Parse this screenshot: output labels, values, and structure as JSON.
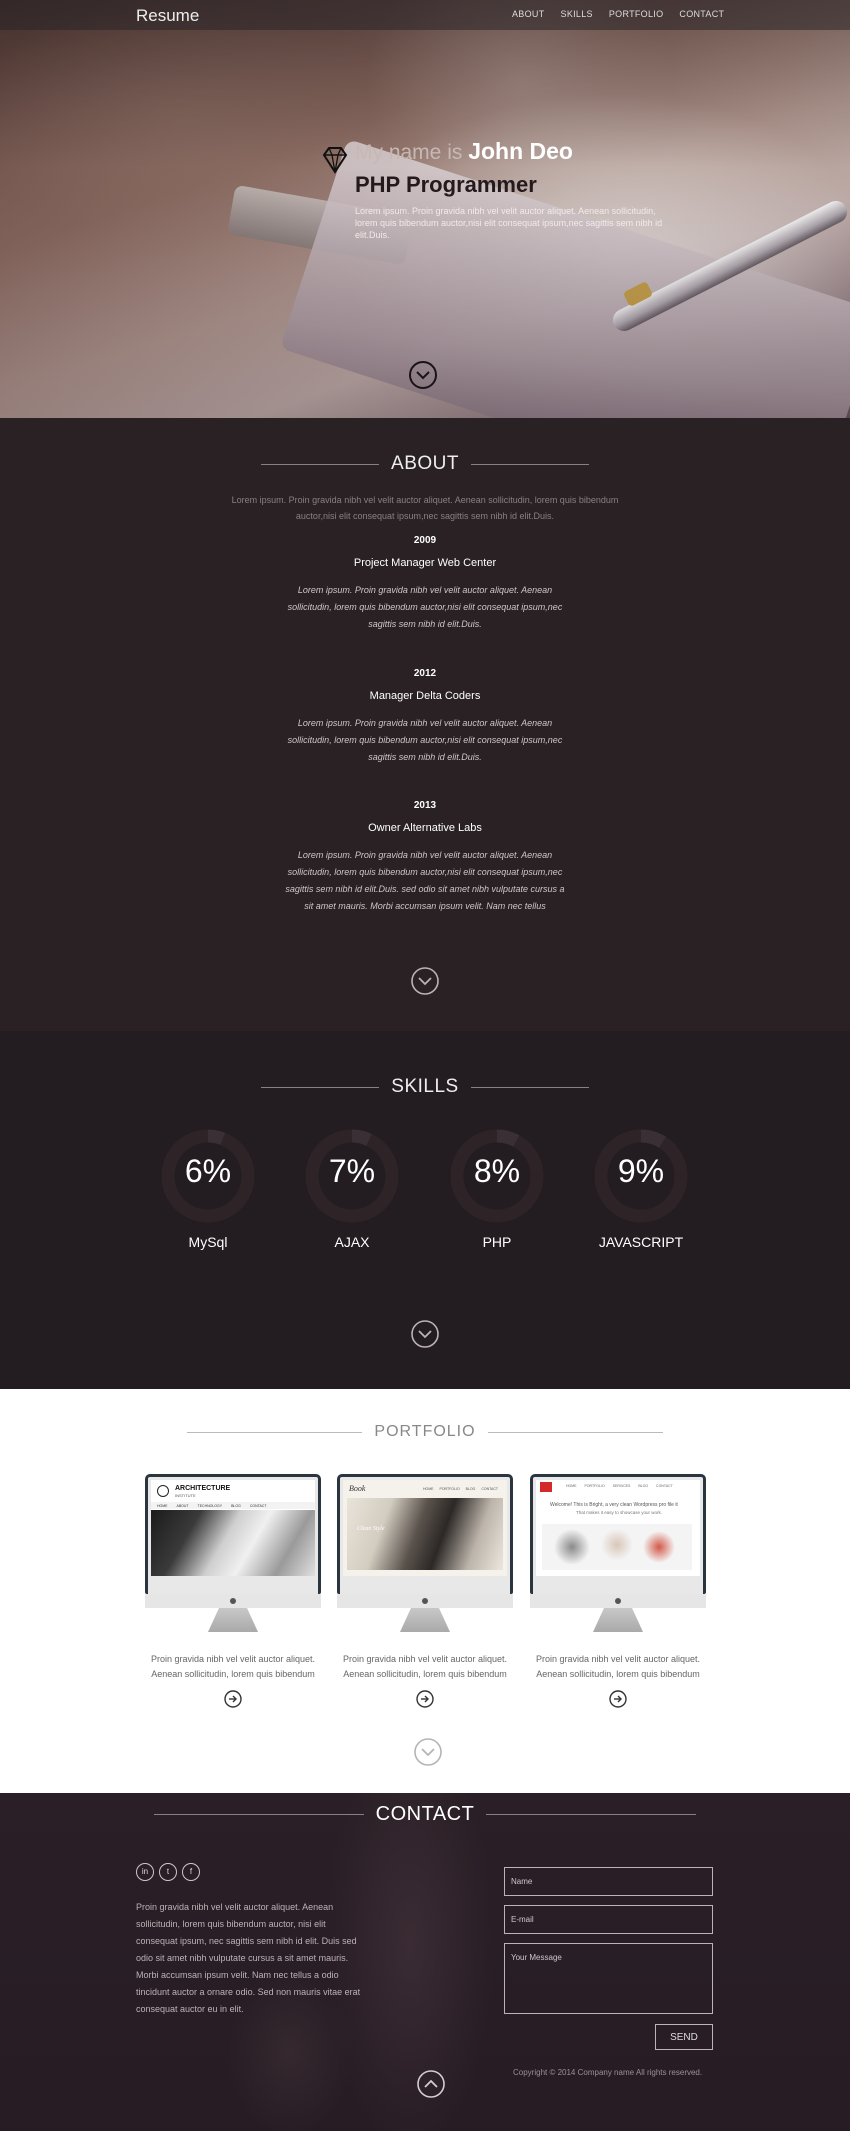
{
  "nav": {
    "brand": "Resume",
    "items": [
      "ABOUT",
      "SKILLS",
      "PORTFOLIO",
      "CONTACT"
    ]
  },
  "hero": {
    "greeting": "My name is ",
    "name": "John Deo",
    "role": "PHP Programmer",
    "desc": "Lorem ipsum. Proin gravida nibh vel velit auctor aliquet. Aenean sollicitudin, lorem quis bibendum auctor,nisi elit consequat ipsum,nec sagittis sem nibh id elit.Duis."
  },
  "about": {
    "title": "ABOUT",
    "intro": "Lorem ipsum. Proin gravida nibh vel velit auctor aliquet. Aenean sollicitudin, lorem quis bibendum auctor,nisi elit consequat ipsum,nec sagittis sem nibh id elit.Duis.",
    "jobs": [
      {
        "year": "2009",
        "title": "Project Manager Web Center",
        "desc": "Lorem ipsum. Proin gravida nibh vel velit auctor aliquet. Aenean sollicitudin, lorem quis bibendum auctor,nisi elit consequat ipsum,nec sagittis sem nibh id elit.Duis."
      },
      {
        "year": "2012",
        "title": "Manager Delta Coders",
        "desc": "Lorem ipsum. Proin gravida nibh vel velit auctor aliquet. Aenean sollicitudin, lorem quis bibendum auctor,nisi elit consequat ipsum,nec sagittis sem nibh id elit.Duis."
      },
      {
        "year": "2013",
        "title": "Owner Alternative Labs",
        "desc": "Lorem ipsum. Proin gravida nibh vel velit auctor aliquet. Aenean sollicitudin, lorem quis bibendum auctor,nisi elit consequat ipsum,nec sagittis sem nibh id elit.Duis. sed odio sit amet nibh vulputate cursus a sit amet mauris. Morbi accumsan ipsum velit. Nam nec tellus"
      }
    ]
  },
  "skills": {
    "title": "SKILLS",
    "items": [
      {
        "pct": "6%",
        "value": 6,
        "name": "MySql"
      },
      {
        "pct": "7%",
        "value": 7,
        "name": "AJAX"
      },
      {
        "pct": "8%",
        "value": 8,
        "name": "PHP"
      },
      {
        "pct": "9%",
        "value": 9,
        "name": "JAVASCRIPT"
      }
    ]
  },
  "portfolio": {
    "title": "PORTFOLIO",
    "items": [
      {
        "line1": "Proin gravida nibh vel velit auctor aliquet.",
        "line2": "Aenean sollicitudin, lorem quis bibendum",
        "screen_title": "ARCHITECTURE",
        "screen_sub": "INSTITUTE",
        "screen_nav": [
          "HOME",
          "ABOUT",
          "TECHNOLOGY",
          "BLOG",
          "CONTACT"
        ]
      },
      {
        "line1": "Proin gravida nibh vel velit auctor aliquet.",
        "line2": "Aenean sollicitudin, lorem quis bibendum",
        "screen_title": "Book",
        "screen_sub": "Clean Style",
        "screen_nav": [
          "HOME",
          "PORTFOLIO",
          "BLOG",
          "CONTACT"
        ]
      },
      {
        "line1": "Proin gravida nibh vel velit auctor aliquet.",
        "line2": "Aenean sollicitudin, lorem quis bibendum",
        "screen_title": "Welcome! This is Bright, a very clean Wordpress pro file it",
        "screen_sub": "That makes it easy to showcase your work.",
        "screen_nav": [
          "HOME",
          "PORTFOLIO",
          "SERVICES",
          "BLOG",
          "CONTACT"
        ]
      }
    ]
  },
  "contact": {
    "title": "CONTACT",
    "social": [
      "in",
      "t",
      "f"
    ],
    "text": "Proin gravida nibh vel velit auctor aliquet. Aenean sollicitudin, lorem quis bibendum auctor, nisi elit consequat ipsum, nec sagittis sem nibh id elit. Duis sed odio sit amet nibh vulputate cursus a sit amet mauris. Morbi accumsan ipsum velit. Nam nec tellus a odio tincidunt auctor a ornare odio. Sed non mauris vitae erat consequat auctor eu in elit.",
    "name_placeholder": "Name",
    "email_placeholder": "E-mail",
    "message_placeholder": "Your Message",
    "send_label": "SEND",
    "copyright": "Copyright © 2014 Company name All rights reserved."
  },
  "colors": {
    "dark": "#2a2125",
    "darker": "#231c20",
    "ring_track": "#2f2529",
    "ring_fill": "#3b3035"
  }
}
